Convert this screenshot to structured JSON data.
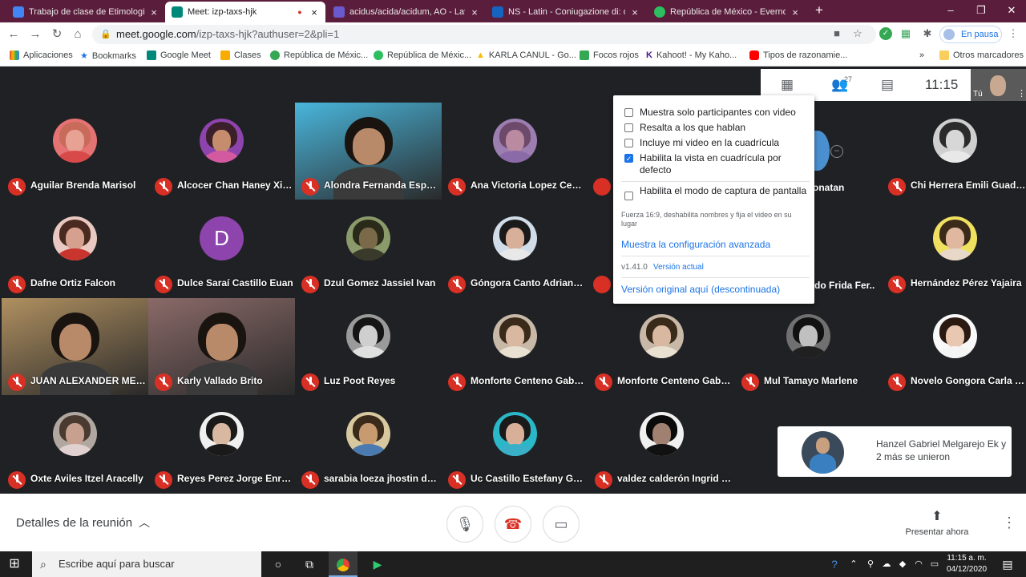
{
  "browser": {
    "tabs": [
      {
        "title": "Trabajo de clase de Etimologías I",
        "active": false,
        "icon_color": "#4285f4"
      },
      {
        "title": "Meet: izp-taxs-hjk",
        "active": true,
        "icon_color": "#00897b"
      },
      {
        "title": "acidus/acida/acidum, AO - Latin",
        "active": false,
        "icon_color": "#6a5acd"
      },
      {
        "title": "NS - Latin - Coniugazione di: del",
        "active": false,
        "icon_color": "#1565c0"
      },
      {
        "title": "República de México - Evernote",
        "active": false,
        "icon_color": "#2dbe60"
      }
    ],
    "new_tab": "+",
    "url_host": "meet.google.com",
    "url_path": "/izp-taxs-hjk?authuser=2&pli=1",
    "profile_status": "En pausa",
    "bookmarks": [
      {
        "label": "Aplicaciones",
        "color": "#e94235"
      },
      {
        "label": "Bookmarks",
        "color": "#1a73e8"
      },
      {
        "label": "Google Meet",
        "color": "#00897b"
      },
      {
        "label": "Clases",
        "color": "#f9ab00"
      },
      {
        "label": "República de Méxic...",
        "color": "#34a853"
      },
      {
        "label": "República de Méxic...",
        "color": "#2dbe60"
      },
      {
        "label": "KARLA CANUL - Go...",
        "color": "#fbbc04"
      },
      {
        "label": "Focos rojos",
        "color": "#34a853"
      },
      {
        "label": "Kahoot! - My Kaho...",
        "color": "#46178f"
      },
      {
        "label": "Tipos de razonamie...",
        "color": "#ff0000"
      }
    ],
    "more_bookmarks": "»",
    "other_bookmarks": "Otros marcadores"
  },
  "meet": {
    "participants_count": "27",
    "clock": "11:15",
    "self_label": "Tú",
    "tiles": [
      {
        "name": "Aguilar Brenda Marisol",
        "type": "avatar",
        "hair": "#c96b5b",
        "face": "#e8a294",
        "body": "#d84a4a",
        "bg": "#e57373"
      },
      {
        "name": "Alcocer Chan Haney Xio...",
        "type": "avatar",
        "hair": "#3b1f2a",
        "face": "#c58d6d",
        "body": "#d35aa0",
        "bg": "#8e44ad"
      },
      {
        "name": "Alondra Fernanda Esparz...",
        "type": "video",
        "bg": "#49b6dc"
      },
      {
        "name": "Ana Victoria Lopez Cebal...",
        "type": "avatar",
        "hair": "#6d4a6b",
        "face": "#b98aa0",
        "body": "#8b6aa8",
        "bg": "#9c7fb0"
      },
      {
        "name": "",
        "type": "hidden"
      },
      {
        "name": "",
        "type": "hidden"
      },
      {
        "name": "Chi Herrera Emili Guadal...",
        "type": "avatar",
        "hair": "#2b2b2b",
        "face": "#d7d7d7",
        "body": "#e8e8e8",
        "bg": "#cfcfcf"
      },
      {
        "name": "Dafne Ortiz Falcon",
        "type": "avatar",
        "hair": "#4a2a20",
        "face": "#d6a08f",
        "body": "#c8352f",
        "bg": "#e8c8c0"
      },
      {
        "name": "Dulce Saraí Castillo Euan",
        "type": "letter",
        "letter": "D"
      },
      {
        "name": "Dzul Gomez Jassiel Ivan",
        "type": "avatar",
        "hair": "#2a2a1a",
        "face": "#7a6a4a",
        "body": "#3a3a2a",
        "bg": "#8a9a6a"
      },
      {
        "name": "Góngora Canto Adriana E...",
        "type": "avatar",
        "hair": "#1a1a1a",
        "face": "#d8b09a",
        "body": "#e8e8e8",
        "bg": "#d0dce8"
      },
      {
        "name": "",
        "type": "hidden"
      },
      {
        "name": "",
        "type": "hidden"
      },
      {
        "name": "Hernández Pérez Yajaira",
        "type": "avatar",
        "hair": "#3a2a1a",
        "face": "#e0b8a0",
        "body": "#e8d8c8",
        "bg": "#f0e060"
      },
      {
        "name": "JUAN ALEXANDER MEN...",
        "type": "video",
        "bg": "#b09060"
      },
      {
        "name": "Karly Vallado Brito",
        "type": "video",
        "bg": "#8a6a68"
      },
      {
        "name": "Luz Poot Reyes",
        "type": "avatar",
        "hair": "#151515",
        "face": "#cfcfcf",
        "body": "#e0e0e0",
        "bg": "#9a9a9a"
      },
      {
        "name": "Monforte Centeno Gabrie...",
        "type": "avatar",
        "hair": "#3a2a1a",
        "face": "#d8b8a0",
        "body": "#e8e0d0",
        "bg": "#c8b8a8"
      },
      {
        "name": "Monforte Centeno Gabrie...",
        "type": "avatar",
        "hair": "#3a2a1a",
        "face": "#d8b8a0",
        "body": "#e8e0d0",
        "bg": "#c8b8a8"
      },
      {
        "name": "Mul Tamayo Marlene",
        "type": "avatar",
        "hair": "#111111",
        "face": "#c0c0c0",
        "body": "#202020",
        "bg": "#707070"
      },
      {
        "name": "Novelo Gongora Carla M...",
        "type": "avatar",
        "hair": "#2a1a12",
        "face": "#e8c8b0",
        "body": "#f4f4f4",
        "bg": "#f8f8f8"
      },
      {
        "name": "Oxte Aviles Itzel Aracelly",
        "type": "avatar",
        "hair": "#4a3a30",
        "face": "#c8a090",
        "body": "#e0d0d0",
        "bg": "#b0a8a0"
      },
      {
        "name": "Reyes Perez Jorge Enrique",
        "type": "avatar",
        "hair": "#1a1a1a",
        "face": "#d8b8a0",
        "body": "#1a1a1a",
        "bg": "#f0f0f0"
      },
      {
        "name": "sarabia loeza jhostin donic",
        "type": "avatar",
        "hair": "#3a2a1a",
        "face": "#c89a70",
        "body": "#4a7ab0",
        "bg": "#d8c8a0"
      },
      {
        "name": "Uc Castillo Estefany Gua...",
        "type": "avatar",
        "hair": "#1a1a1a",
        "face": "#d8b09a",
        "body": "#3ab0c8",
        "bg": "#2ab8c8"
      },
      {
        "name": "valdez calderón Ingrid Xi...",
        "type": "avatar",
        "hair": "#0a0a0a",
        "face": "#a08070",
        "body": "#111111",
        "bg": "#f0f0f0"
      }
    ],
    "partial_names": {
      "row1": "onatan",
      "row2": "do Frida Fer..."
    },
    "settings_popup": {
      "options": [
        {
          "label": "Muestra solo participantes con video",
          "checked": false
        },
        {
          "label": "Resalta a los que hablan",
          "checked": false
        },
        {
          "label": "Incluye mi video en la cuadrícula",
          "checked": false
        },
        {
          "label": "Habilita la vista en cuadrícula por defecto",
          "checked": true
        },
        {
          "label": "Habilita el modo de captura de pantalla",
          "checked": false
        }
      ],
      "note": "Fuerza 16:9, deshabilita nombres y fija el video en su lugar",
      "advanced_link": "Muestra la configuración avanzada",
      "version": "v1.41.0",
      "version_link": "Versión actual",
      "original_link": "Versión original aquí (descontinuada)"
    },
    "join_toast": "Hanzel Gabriel Melgarejo Ek y 2 más se unieron",
    "bottom": {
      "details_label": "Detalles de la reunión",
      "present_label": "Presentar ahora"
    }
  },
  "taskbar": {
    "search_placeholder": "Escribe aquí para buscar",
    "time": "11:15 a. m.",
    "date": "04/12/2020"
  }
}
